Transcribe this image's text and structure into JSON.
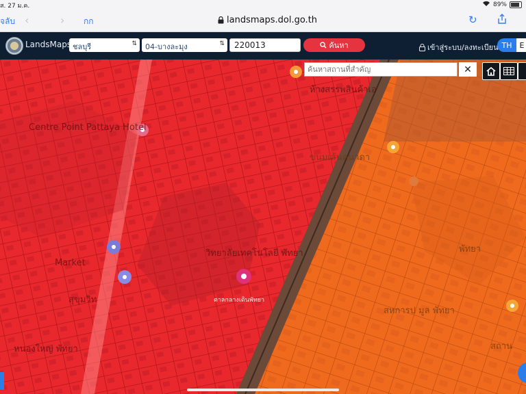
{
  "status": {
    "time": "ส. 27 ม.ค.",
    "battery": "89%"
  },
  "browser": {
    "back_label": "จลับ",
    "text_size": "กก",
    "url": "landsmaps.dol.go.th"
  },
  "app": {
    "brand": "LandsMaps",
    "province": "ชลบุรี",
    "district": "04-บางละมุง",
    "parcel_no": "220013",
    "search_label": "ค้นหา",
    "login_label": "เข้าสู่ระบบ/ลงทะเบียน",
    "lang_th": "TH",
    "lang_en": "E"
  },
  "map": {
    "poi_search_placeholder": "ค้นหาสถานที่สำคัญ",
    "labels": {
      "hotel": "Centre Point Pattaya Hotel",
      "market": "Market",
      "crossing": "ขนมเส้นคนาดา",
      "bangkok_hospital": "วิทยาลัยเทคโนโลยี พัทยา",
      "mall": "ห้างสรรพสินค้าเอ",
      "city": "พัทยา",
      "municipal": "สหการป มูล พัทยา",
      "station": "สถาน",
      "thai_south": "หนองใหญ่ พัทยา",
      "thai_west": "สุขุมวิท",
      "district_sm": "ตาลกลางเดินพัทยา"
    }
  }
}
